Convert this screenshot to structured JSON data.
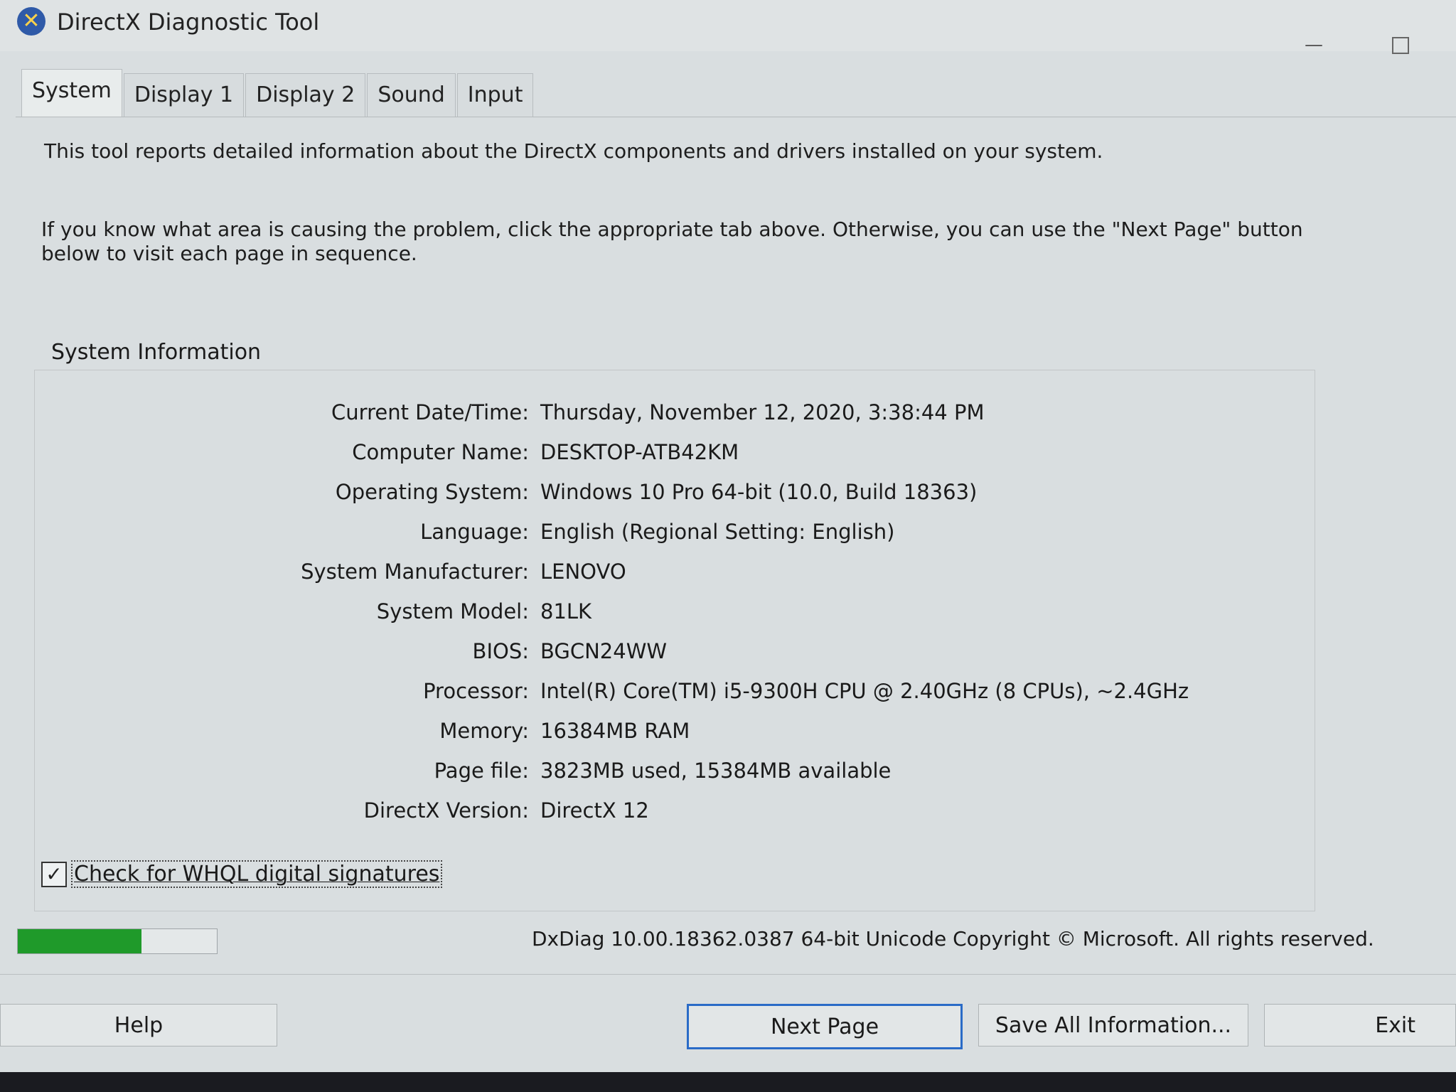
{
  "window": {
    "title": "DirectX Diagnostic Tool",
    "icon": "directx-icon",
    "minimize_glyph": "—"
  },
  "tabs": [
    {
      "label": "System",
      "active": true
    },
    {
      "label": "Display 1",
      "active": false
    },
    {
      "label": "Display 2",
      "active": false
    },
    {
      "label": "Sound",
      "active": false
    },
    {
      "label": "Input",
      "active": false
    }
  ],
  "intro": {
    "line1": "This tool reports detailed information about the DirectX components and drivers installed on your system.",
    "line2": "If you know what area is causing the problem, click the appropriate tab above.  Otherwise, you can use the \"Next Page\" button below to visit each page in sequence."
  },
  "system_info": {
    "group_label": "System Information",
    "rows": [
      {
        "label": "Current Date/Time:",
        "value": "Thursday, November 12, 2020, 3:38:44 PM"
      },
      {
        "label": "Computer Name:",
        "value": "DESKTOP-ATB42KM"
      },
      {
        "label": "Operating System:",
        "value": "Windows 10 Pro 64-bit (10.0, Build 18363)"
      },
      {
        "label": "Language:",
        "value": "English (Regional Setting: English)"
      },
      {
        "label": "System Manufacturer:",
        "value": "LENOVO"
      },
      {
        "label": "System Model:",
        "value": "81LK"
      },
      {
        "label": "BIOS:",
        "value": "BGCN24WW"
      },
      {
        "label": "Processor:",
        "value": "Intel(R) Core(TM) i5-9300H CPU @ 2.40GHz (8 CPUs), ~2.4GHz"
      },
      {
        "label": "Memory:",
        "value": "16384MB RAM"
      },
      {
        "label": "Page file:",
        "value": "3823MB used, 15384MB available"
      },
      {
        "label": "DirectX Version:",
        "value": "DirectX 12"
      }
    ]
  },
  "whql": {
    "label": "Check for WHQL digital signatures",
    "checked": true,
    "check_glyph": "✓"
  },
  "progress": {
    "fraction": 0.62,
    "color": "#1f9a2a"
  },
  "copyright": "DxDiag 10.00.18362.0387 64-bit Unicode  Copyright © Microsoft. All rights reserved.",
  "buttons": {
    "help": "Help",
    "next_page": "Next Page",
    "save_all": "Save All Information...",
    "exit": "Exit"
  }
}
